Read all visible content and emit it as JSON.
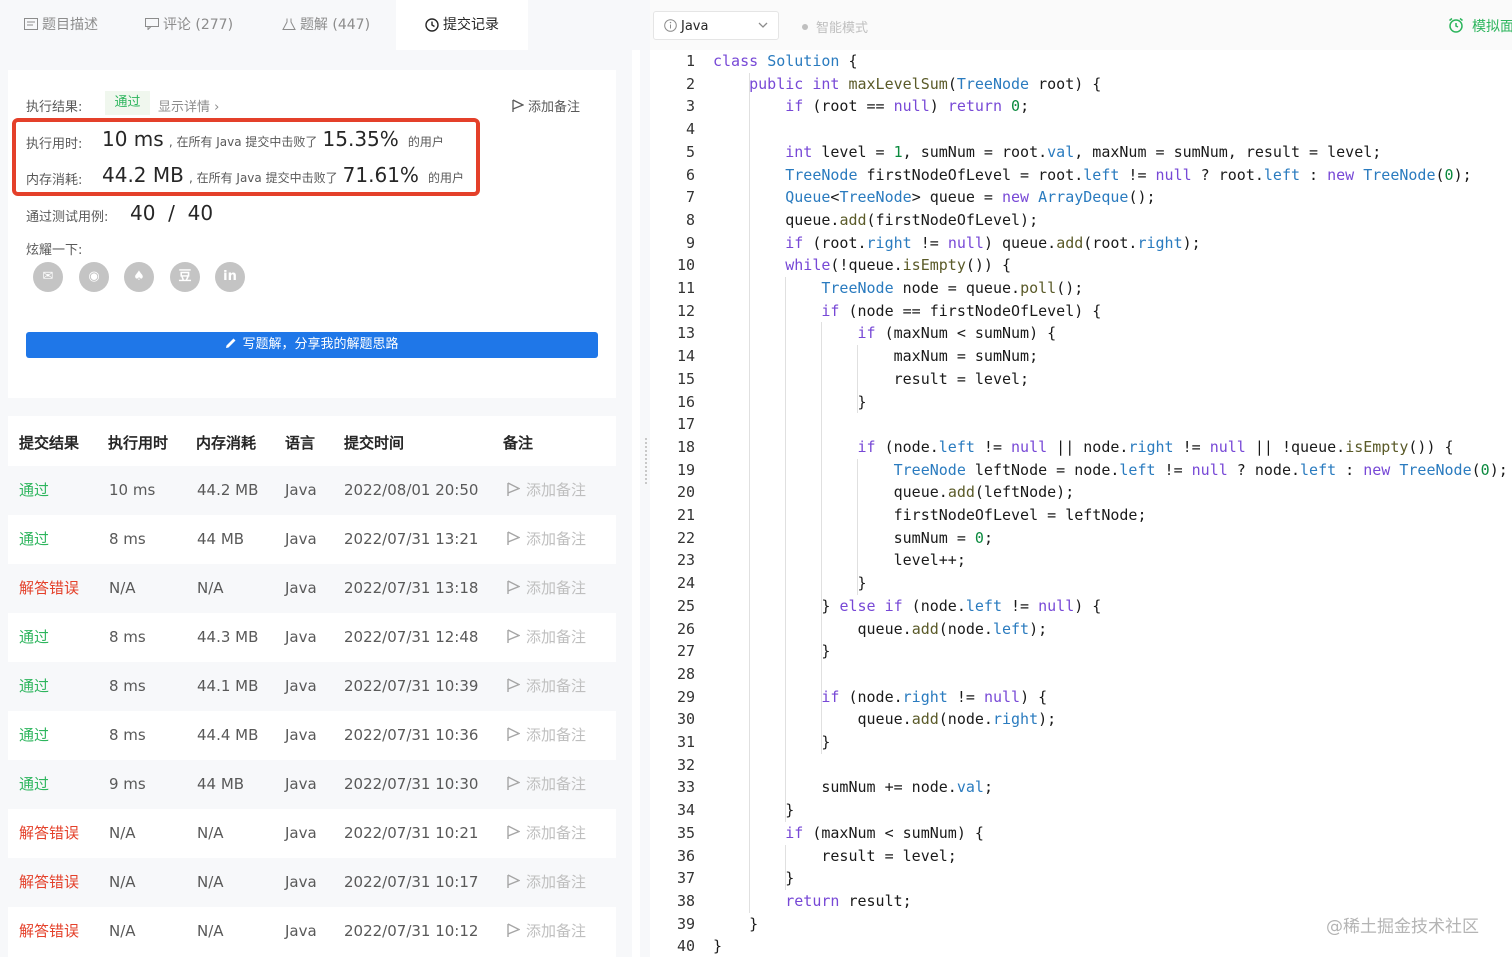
{
  "tabs": [
    {
      "label": "题目描述",
      "icon": "document-icon"
    },
    {
      "label": "评论 (277)",
      "icon": "comment-icon"
    },
    {
      "label": "题解 (447)",
      "icon": "flask-icon"
    },
    {
      "label": "提交记录",
      "icon": "clock-icon"
    }
  ],
  "result": {
    "label": "执行结果:",
    "status": "通过",
    "detail": "显示详情 ›",
    "add_note": "添加备注",
    "runtime_label": "执行用时:",
    "runtime_value": "10 ms",
    "runtime_text": ", 在所有 Java 提交中击败了",
    "runtime_pct": "15.35%",
    "runtime_suffix": "的用户",
    "memory_label": "内存消耗:",
    "memory_value": "44.2 MB",
    "memory_text": ", 在所有 Java 提交中击败了",
    "memory_pct": "71.61%",
    "memory_suffix": "的用户",
    "tests_label": "通过测试用例:",
    "tests_value": "40  /  40",
    "share_label": "炫耀一下:",
    "share_icons": [
      "wechat-icon",
      "weibo-icon",
      "qq-icon",
      "douban-icon",
      "linkedin-icon"
    ],
    "share_glyphs": [
      "✉",
      "◉",
      "♠",
      "豆",
      "in"
    ],
    "write_solution": "写题解，分享我的解题思路"
  },
  "table": {
    "headers": [
      "提交结果",
      "执行用时",
      "内存消耗",
      "语言",
      "提交时间",
      "备注"
    ],
    "rows": [
      {
        "status": "通过",
        "ok": true,
        "time": "10 ms",
        "mem": "44.2 MB",
        "lang": "Java",
        "date": "2022/08/01 20:50",
        "note": "添加备注"
      },
      {
        "status": "通过",
        "ok": true,
        "time": "8 ms",
        "mem": "44 MB",
        "lang": "Java",
        "date": "2022/07/31 13:21",
        "note": "添加备注"
      },
      {
        "status": "解答错误",
        "ok": false,
        "time": "N/A",
        "mem": "N/A",
        "lang": "Java",
        "date": "2022/07/31 13:18",
        "note": "添加备注"
      },
      {
        "status": "通过",
        "ok": true,
        "time": "8 ms",
        "mem": "44.3 MB",
        "lang": "Java",
        "date": "2022/07/31 12:48",
        "note": "添加备注"
      },
      {
        "status": "通过",
        "ok": true,
        "time": "8 ms",
        "mem": "44.1 MB",
        "lang": "Java",
        "date": "2022/07/31 10:39",
        "note": "添加备注"
      },
      {
        "status": "通过",
        "ok": true,
        "time": "8 ms",
        "mem": "44.4 MB",
        "lang": "Java",
        "date": "2022/07/31 10:36",
        "note": "添加备注"
      },
      {
        "status": "通过",
        "ok": true,
        "time": "9 ms",
        "mem": "44 MB",
        "lang": "Java",
        "date": "2022/07/31 10:30",
        "note": "添加备注"
      },
      {
        "status": "解答错误",
        "ok": false,
        "time": "N/A",
        "mem": "N/A",
        "lang": "Java",
        "date": "2022/07/31 10:21",
        "note": "添加备注"
      },
      {
        "status": "解答错误",
        "ok": false,
        "time": "N/A",
        "mem": "N/A",
        "lang": "Java",
        "date": "2022/07/31 10:17",
        "note": "添加备注"
      },
      {
        "status": "解答错误",
        "ok": false,
        "time": "N/A",
        "mem": "N/A",
        "lang": "Java",
        "date": "2022/07/31 10:12",
        "note": "添加备注"
      }
    ]
  },
  "editor": {
    "language": "Java",
    "smart_mode": "智能模式",
    "mock_label": "模拟面",
    "watermark": "@稀土掘金技术社区",
    "code_lines": [
      "class Solution {",
      "    public int maxLevelSum(TreeNode root) {",
      "        if (root == null) return 0;",
      "",
      "        int level = 1, sumNum = root.val, maxNum = sumNum, result = level;",
      "        TreeNode firstNodeOfLevel = root.left != null ? root.left : new TreeNode(0);",
      "        Queue<TreeNode> queue = new ArrayDeque();",
      "        queue.add(firstNodeOfLevel);",
      "        if (root.right != null) queue.add(root.right);",
      "        while(!queue.isEmpty()) {",
      "            TreeNode node = queue.poll();",
      "            if (node == firstNodeOfLevel) {",
      "                if (maxNum < sumNum) {",
      "                    maxNum = sumNum;",
      "                    result = level;",
      "                }",
      "",
      "                if (node.left != null || node.right != null || !queue.isEmpty()) {",
      "                    TreeNode leftNode = node.left != null ? node.left : new TreeNode(0);",
      "                    queue.add(leftNode);",
      "                    firstNodeOfLevel = leftNode;",
      "                    sumNum = 0;",
      "                    level++;",
      "                }",
      "            } else if (node.left != null) {",
      "                queue.add(node.left);",
      "            }",
      "",
      "            if (node.right != null) {",
      "                queue.add(node.right);",
      "            }",
      "",
      "            sumNum += node.val;",
      "        }",
      "        if (maxNum < sumNum) {",
      "            result = level;",
      "        }",
      "        return result;",
      "    }",
      "}"
    ]
  }
}
